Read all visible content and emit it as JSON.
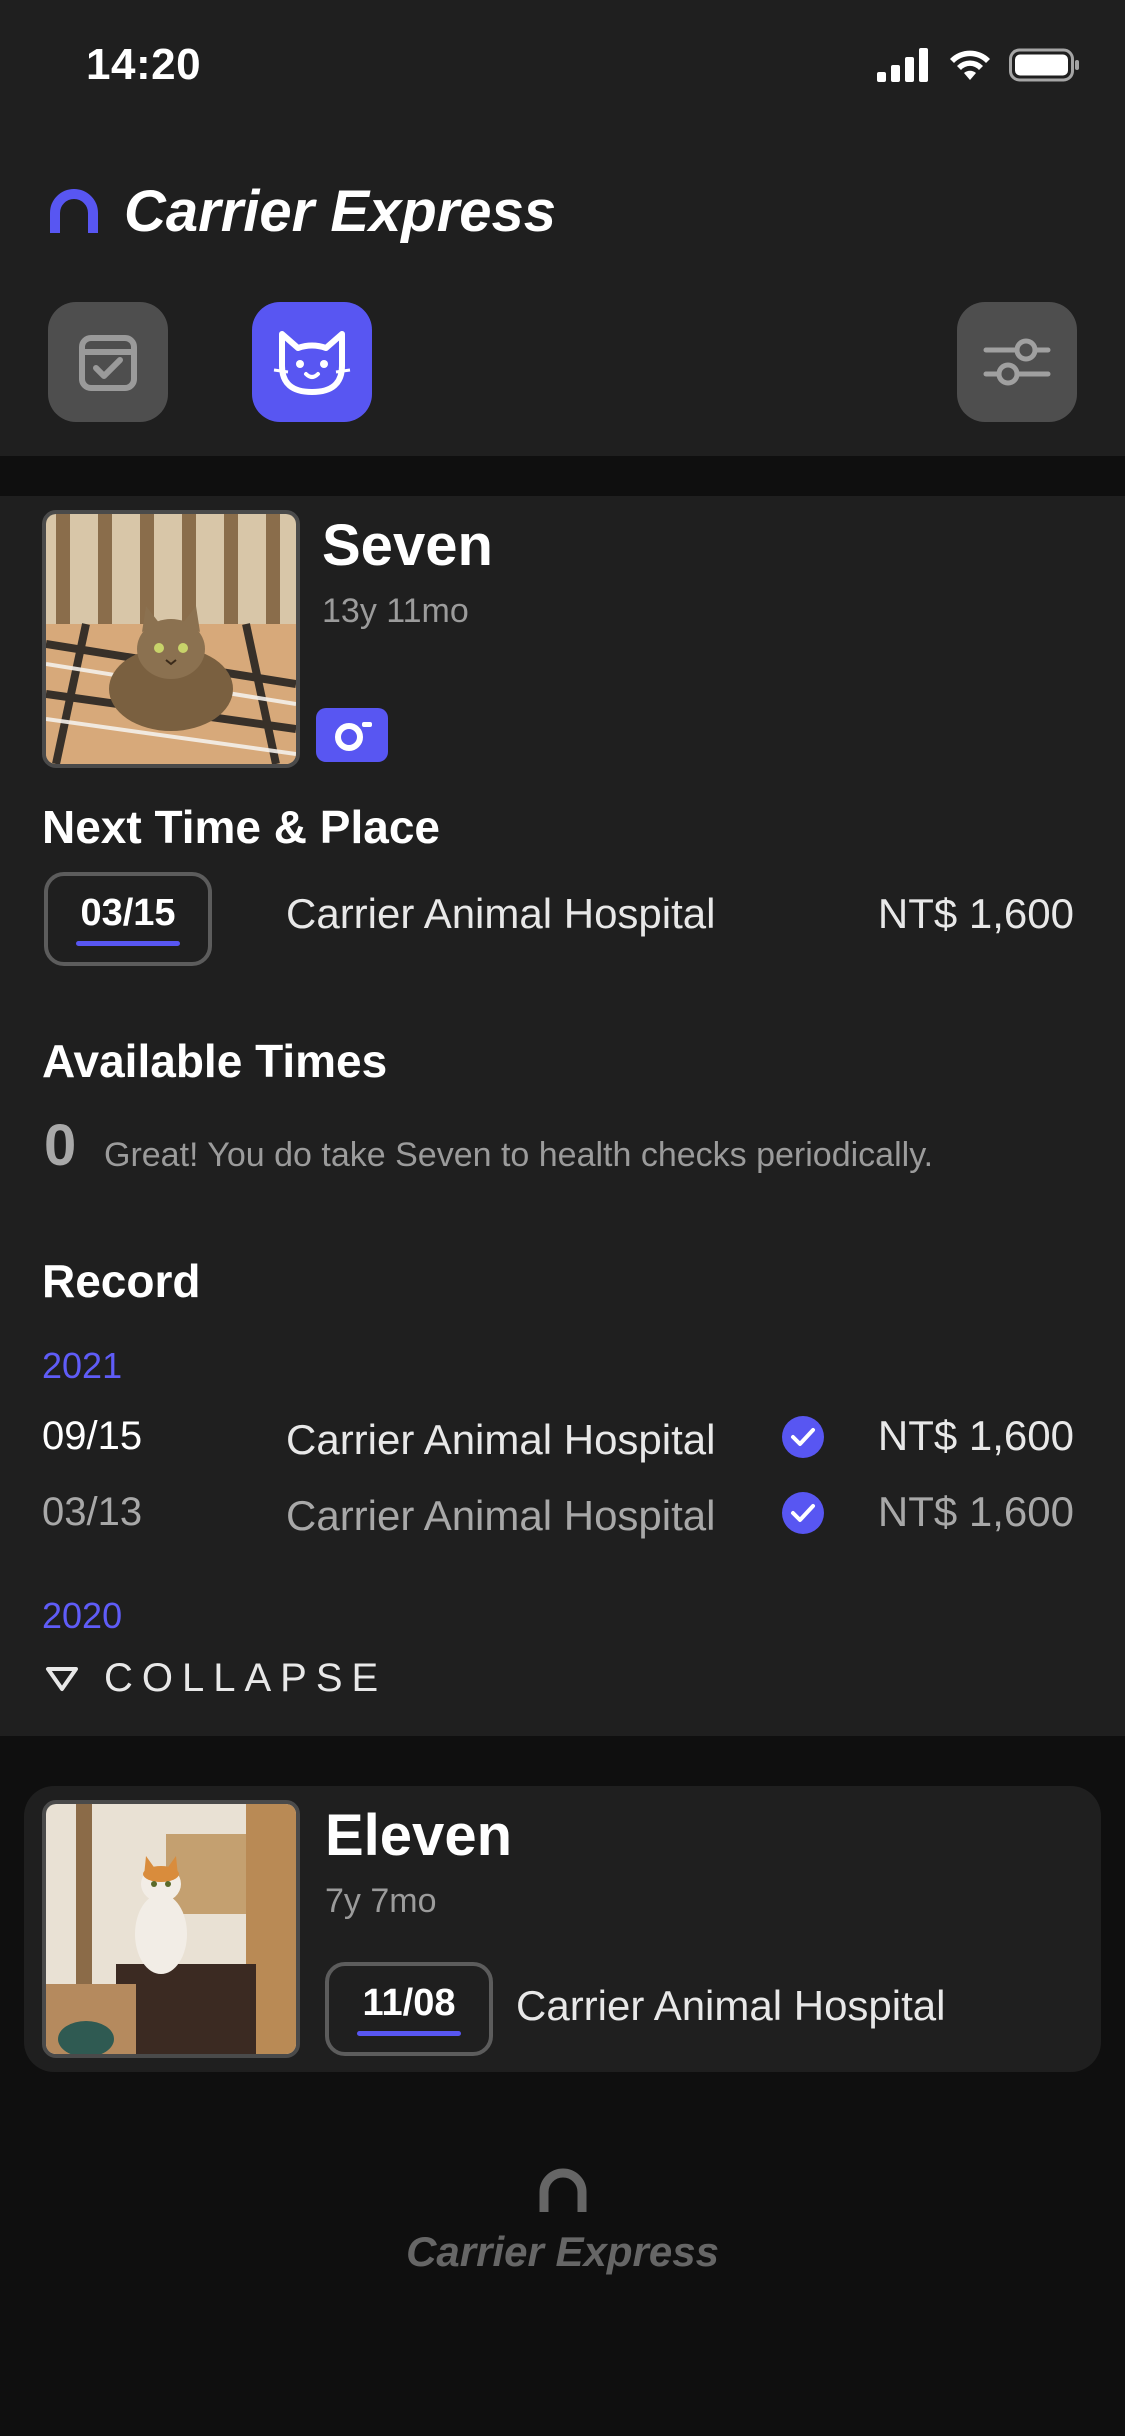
{
  "status_bar": {
    "time": "14:20"
  },
  "app": {
    "title": "Carrier Express"
  },
  "toolbar": {
    "calendar_icon": "calendar-check-icon",
    "cat_icon": "cat-face-icon",
    "filter_icon": "sliders-icon"
  },
  "colors": {
    "accent": "#5856f2",
    "background": "#0f0f0f",
    "card": "#1f1f1f"
  },
  "pets": [
    {
      "name": "Seven",
      "age": "13y 11mo",
      "next": {
        "section_title": "Next Time & Place",
        "date": "03/15",
        "place": "Carrier Animal Hospital",
        "price": "NT$ 1,600"
      },
      "available": {
        "section_title": "Available Times",
        "count": "0",
        "message": "Great! You do take Seven to health checks periodically."
      },
      "record": {
        "section_title": "Record",
        "years": [
          {
            "year": "2021",
            "entries": [
              {
                "date": "09/15",
                "place": "Carrier Animal Hospital",
                "price": "NT$ 1,600",
                "checked": true
              },
              {
                "date": "03/13",
                "place": "Carrier Animal Hospital",
                "price": "NT$ 1,600",
                "checked": true
              }
            ]
          },
          {
            "year": "2020",
            "entries": []
          }
        ],
        "collapse_label": "COLLAPSE"
      }
    },
    {
      "name": "Eleven",
      "age": "7y 7mo",
      "next": {
        "date": "11/08",
        "place": "Carrier Animal Hospital"
      }
    }
  ],
  "footer": {
    "title": "Carrier Express"
  }
}
